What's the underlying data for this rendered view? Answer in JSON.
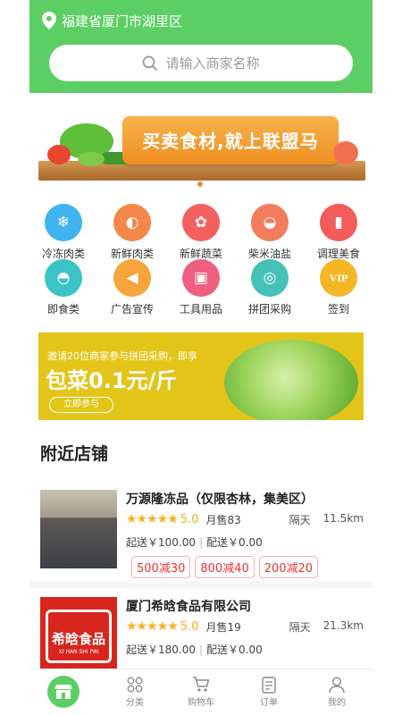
{
  "location": {
    "text": "福建省厦门市湖里区"
  },
  "search": {
    "placeholder": "请输入商家名称"
  },
  "banner": {
    "text": "买卖食材,就上联盟马"
  },
  "categories": [
    {
      "label": "冷冻肉类",
      "icon": "snowflake-icon",
      "color": "#3fb4ee",
      "glyph": "❄"
    },
    {
      "label": "新鲜肉类",
      "icon": "meat-icon",
      "color": "#f5874a",
      "glyph": "🥩"
    },
    {
      "label": "新鲜蔬菜",
      "icon": "vegetable-icon",
      "color": "#f46060",
      "glyph": "🥦"
    },
    {
      "label": "柴米油盐",
      "icon": "rice-bowl-icon",
      "color": "#f27d5c",
      "glyph": "🍚"
    },
    {
      "label": "调理美食",
      "icon": "seasoning-icon",
      "color": "#f45b5b",
      "glyph": "🧂"
    },
    {
      "label": "即食类",
      "icon": "instant-food-icon",
      "color": "#3cc3c6",
      "glyph": "🍜"
    },
    {
      "label": "广告宣传",
      "icon": "megaphone-icon",
      "color": "#f6a43c",
      "glyph": "📢"
    },
    {
      "label": "工具用品",
      "icon": "cooker-icon",
      "color": "#ef5f82",
      "glyph": "🍲"
    },
    {
      "label": "拼团采购",
      "icon": "group-buy-icon",
      "color": "#45c1b8",
      "glyph": "🤝"
    },
    {
      "label": "签到",
      "icon": "vip-icon",
      "color": "#f5b625",
      "glyph": "VIP"
    }
  ],
  "promo": {
    "line1": "邀请20位商家参与拼团采购，即享",
    "line2": "包菜0.1元/斤",
    "button": "立即参与"
  },
  "nearby": {
    "title": "附近店铺",
    "stores": [
      {
        "name": "万源隆冻品（仅限杏林，集美区）",
        "stars": "★★★★★",
        "score": "5.0",
        "sold": "月售83",
        "delivery_day": "隔天",
        "distance": "11.5km",
        "min_order": "起送￥100.00",
        "delivery_fee": "配送￥0.00",
        "tags": [
          "500减30",
          "800减40",
          "200减20"
        ]
      },
      {
        "name": "厦门希晗食品有限公司",
        "stars": "★★★★★",
        "score": "5.0",
        "sold": "月售19",
        "delivery_day": "隔天",
        "distance": "21.3km",
        "min_order": "起送￥180.00",
        "delivery_fee": "配送￥0.00",
        "logo_text": "希晗食品",
        "logo_sub": "XI HAN SHI PIN"
      }
    ]
  },
  "nav": {
    "category": "分类",
    "cart": "购物车",
    "orders": "订单",
    "mine": "我的"
  },
  "colors": {
    "brand_green": "#5ccf64",
    "tag_red": "#e33333",
    "star": "#f6b21d"
  }
}
